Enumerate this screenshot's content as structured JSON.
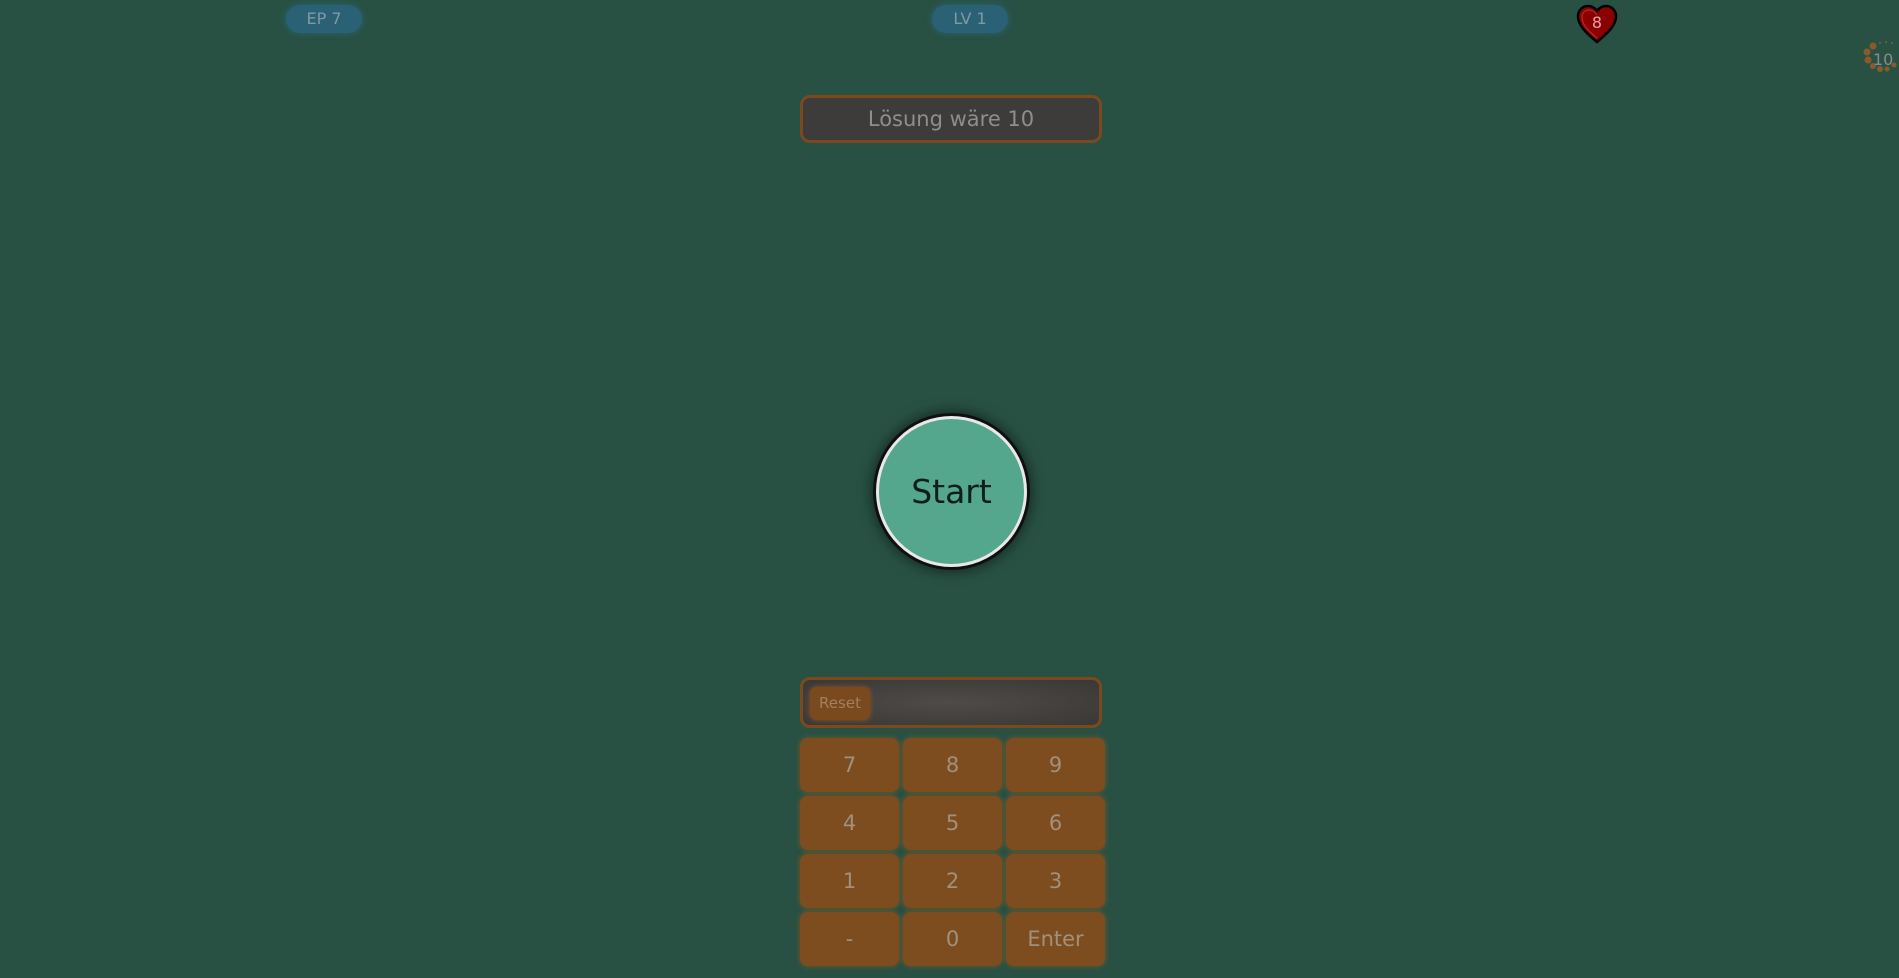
{
  "header": {
    "episode_label": "EP 7",
    "level_label": "LV 1",
    "lives": "8",
    "timer": "10"
  },
  "solution_text": "Lösung wäre 10",
  "start_label": "Start",
  "input": {
    "value": "",
    "reset_label": "Reset"
  },
  "keypad": {
    "keys": [
      "7",
      "8",
      "9",
      "4",
      "5",
      "6",
      "1",
      "2",
      "3",
      "-",
      "0",
      "Enter"
    ]
  },
  "colors": {
    "background": "#285144",
    "start_button": "#54a78c",
    "key": "#7d4d20",
    "heart": "#8b0000",
    "pill": "#2a6174"
  }
}
